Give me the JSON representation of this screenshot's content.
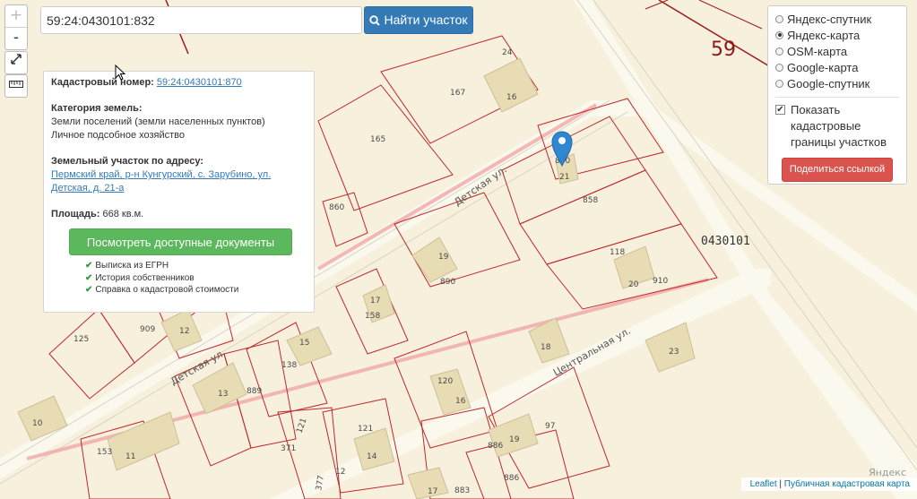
{
  "search": {
    "value": "59:24:0430101:832",
    "button_label": "Найти участок"
  },
  "controls": {
    "zoom_in": "+",
    "zoom_out": "-"
  },
  "popup": {
    "cadastral_label": "Кадастровый номер:",
    "cadastral_value": "59:24:0430101:870",
    "category_label": "Категория земель:",
    "category_line1": "Земли поселений (земли населенных пунктов)",
    "category_line2": "Личное подсобное хозяйство",
    "address_label": "Земельный участок по адресу:",
    "address_value": "Пермский край, р-н Кунгурский, с. Зарубино, ул. Детская, д. 21-а",
    "area_label": "Площадь:",
    "area_value": "668 кв.м.",
    "docs_button": "Посмотреть доступные документы",
    "checklist": [
      "Выписка из ЕГРН",
      "История собственников",
      "Справка о кадастровой стоимости"
    ]
  },
  "layers": {
    "options": [
      {
        "label": "Яндекс-спутник",
        "selected": false
      },
      {
        "label": "Яндекс-карта",
        "selected": true
      },
      {
        "label": "OSM-карта",
        "selected": false
      },
      {
        "label": "Google-карта",
        "selected": false
      },
      {
        "label": "Google-спутник",
        "selected": false
      }
    ],
    "show_borders_label": "Показать кадастровые границы участков",
    "show_borders_checked": true,
    "share_button": "Поделиться ссылкой"
  },
  "map": {
    "streets": [
      "Детская ул.",
      "Детская ул.",
      "Центральная ул."
    ],
    "big_labels": [
      "59",
      "24"
    ],
    "quarter": "0430101",
    "parcels": [
      "167",
      "16",
      "165",
      "870",
      "21",
      "858",
      "860",
      "118",
      "910",
      "20",
      "19",
      "890",
      "17",
      "158",
      "125",
      "909",
      "12",
      "15",
      "138",
      "18",
      "23",
      "13",
      "889",
      "120",
      "16",
      "10",
      "121",
      "97",
      "371",
      "121",
      "14",
      "886",
      "19",
      "153",
      "11",
      "886",
      "377",
      "17",
      "883",
      "12"
    ],
    "marker_color": "#2f86d1",
    "parcel_border_color": "#c0272d",
    "background_color": "#f6f0dd"
  },
  "attribution": {
    "leaflet": "Leaflet",
    "separator": " | ",
    "source": "Публичная кадастровая карта",
    "yandex": "Яндекс"
  }
}
